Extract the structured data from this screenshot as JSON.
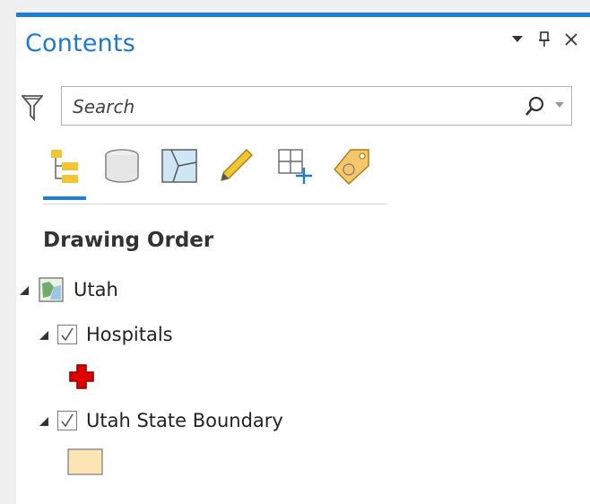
{
  "pane": {
    "title": "Contents",
    "controls": {
      "menu": "menu",
      "pin": "pin",
      "close": "close"
    }
  },
  "search": {
    "placeholder": "Search"
  },
  "toolbar": {
    "tools": [
      {
        "name": "list-by-drawing-order",
        "active": true
      },
      {
        "name": "list-by-data-source",
        "active": false
      },
      {
        "name": "list-by-selection",
        "active": false
      },
      {
        "name": "list-by-editing",
        "active": false
      },
      {
        "name": "list-by-snapping",
        "active": false
      },
      {
        "name": "list-by-labeling",
        "active": false
      }
    ]
  },
  "section": {
    "title": "Drawing Order"
  },
  "tree": {
    "map": {
      "label": "Utah"
    },
    "layers": [
      {
        "label": "Hospitals",
        "checked": true,
        "symbol": "red-cross",
        "symbol_color": "#e00000"
      },
      {
        "label": "Utah State Boundary",
        "checked": true,
        "symbol": "polygon-fill",
        "symbol_color": "#fde4b5"
      }
    ]
  },
  "colors": {
    "accent": "#1b7fd6",
    "title": "#1f78d1"
  }
}
